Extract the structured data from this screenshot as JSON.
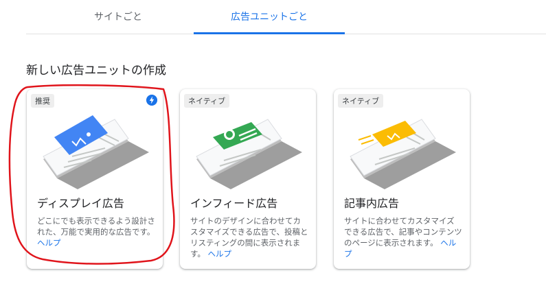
{
  "tabs": [
    {
      "label": "サイトごと",
      "active": false
    },
    {
      "label": "広告ユニットごと",
      "active": true
    }
  ],
  "section_title": "新しい広告ユニットの作成",
  "cards": [
    {
      "badge": "推奨",
      "title": "ディスプレイ広告",
      "description": "どこにでも表示できるよう設計された、万能で実用的な広告です。",
      "help": "ヘルプ",
      "icon": "bolt-icon",
      "accent": "#4285f4"
    },
    {
      "badge": "ネイティブ",
      "title": "インフィード広告",
      "description": "サイトのデザインに合わせてカスタマイズできる広告で、投稿とリスティングの間に表示されます。",
      "help": "ヘルプ",
      "accent": "#34a853"
    },
    {
      "badge": "ネイティブ",
      "title": "記事内広告",
      "description": "サイトに合わせてカスタマイズできる広告で、記事やコンテンツのページに表示されます。",
      "help": "ヘルプ",
      "accent": "#fbbc04"
    }
  ],
  "annotation_color": "#e0141b"
}
